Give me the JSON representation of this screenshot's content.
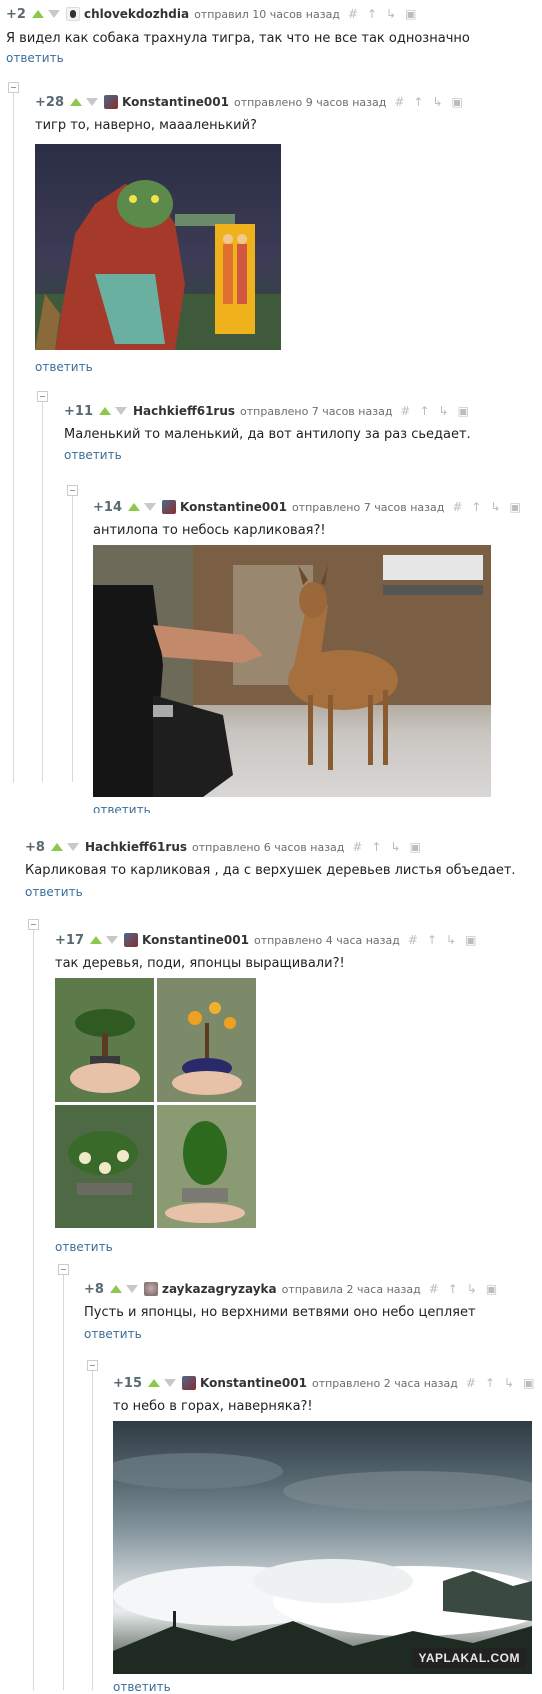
{
  "tools": {
    "hash": "#",
    "arrow": "↑",
    "thread": "↳",
    "save": "▣"
  },
  "reply_label": "ответить",
  "comments": [
    {
      "score": "+2",
      "user": "chlovekdozhdia",
      "time": "отправил 10 часов назад",
      "text": "Я видел как собака трахнула тигра, так что не все так однозначно"
    },
    {
      "score": "+28",
      "user": "Konstantine001",
      "time": "отправлено 9 часов назад",
      "text": "тигр то, наверно, маааленький?"
    },
    {
      "score": "+11",
      "user": "Hachkieff61rus",
      "time": "отправлено 7 часов назад",
      "text": "Маленький то маленький, да вот антилопу за раз сьедает."
    },
    {
      "score": "+14",
      "user": "Konstantine001",
      "time": "отправлено 7 часов назад",
      "text": "антилопа то небось карликовая?!"
    },
    {
      "score": "+8",
      "user": "Hachkieff61rus",
      "time": "отправлено 6 часов назад",
      "text": "Карликовая то карликовая , да с верхушек деревьев листья объедает."
    },
    {
      "score": "+17",
      "user": "Konstantine001",
      "time": "отправлено 4 часа назад",
      "text": "так деревья, поди, японцы выращивали?!"
    },
    {
      "score": "+8",
      "user": "zaykazagryzayka",
      "time": "отправила 2 часа назад",
      "text": "Пусть и японцы, но верхними ветвями оно небо цепляет"
    },
    {
      "score": "+15",
      "user": "Konstantine001",
      "time": "отправлено 2 часа назад",
      "text": "то небо в горах, наверняка?!"
    }
  ],
  "watermark": "YAPLAKAL.COM"
}
